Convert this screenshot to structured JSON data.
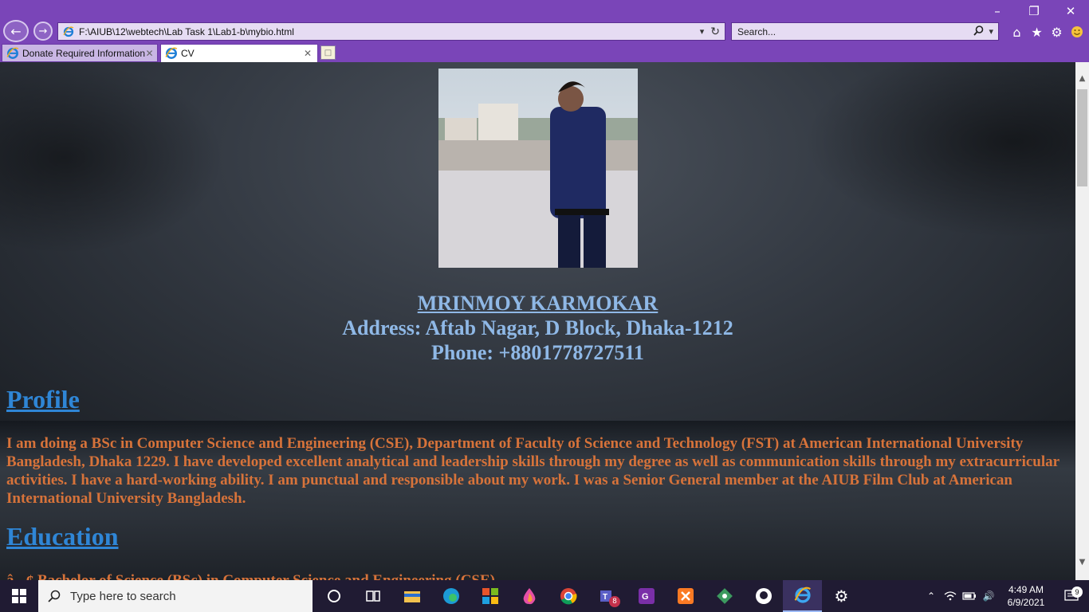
{
  "browser": {
    "address": "F:\\AIUB\\12\\webtech\\Lab Task 1\\Lab1-b\\mybio.html",
    "search_placeholder": "Search...",
    "tabs": [
      {
        "label": "Donate Required Information"
      },
      {
        "label": "CV"
      }
    ]
  },
  "page": {
    "name": "MRINMOY KARMOKAR",
    "address": "Address: Aftab Nagar, D Block, Dhaka-1212",
    "phone": "Phone: +8801778727511",
    "profile_heading": "Profile",
    "profile_text": "I am doing a BSc in Computer Science and Engineering (CSE), Department of Faculty of Science and Technology (FST) at American International University Bangladesh, Dhaka 1229. I have developed excellent analytical and leadership skills through my degree as well as communication skills through my extracurricular activities. I have a hard-working ability. I am punctual and responsible about my work. I was a Senior General member at the AIUB Film Club at American International University Bangladesh.",
    "education_heading": "Education",
    "education_items": [
      "â¢ Bachelor of Science (BSc) in Computer Science and Engineering (CSE)"
    ]
  },
  "taskbar": {
    "search_placeholder": "Type here to search",
    "time": "4:49 AM",
    "date": "6/9/2021",
    "teams_badge": "8",
    "notification_count": "9",
    "pinned": [
      "cortana-icon",
      "task-view-icon",
      "file-explorer-icon",
      "edge-icon",
      "office-icon",
      "paint-drop-icon",
      "chrome-icon",
      "teams-icon",
      "pdf-icon",
      "xampp-icon",
      "git-icon",
      "github-icon",
      "internet-explorer-icon",
      "settings-icon"
    ]
  }
}
